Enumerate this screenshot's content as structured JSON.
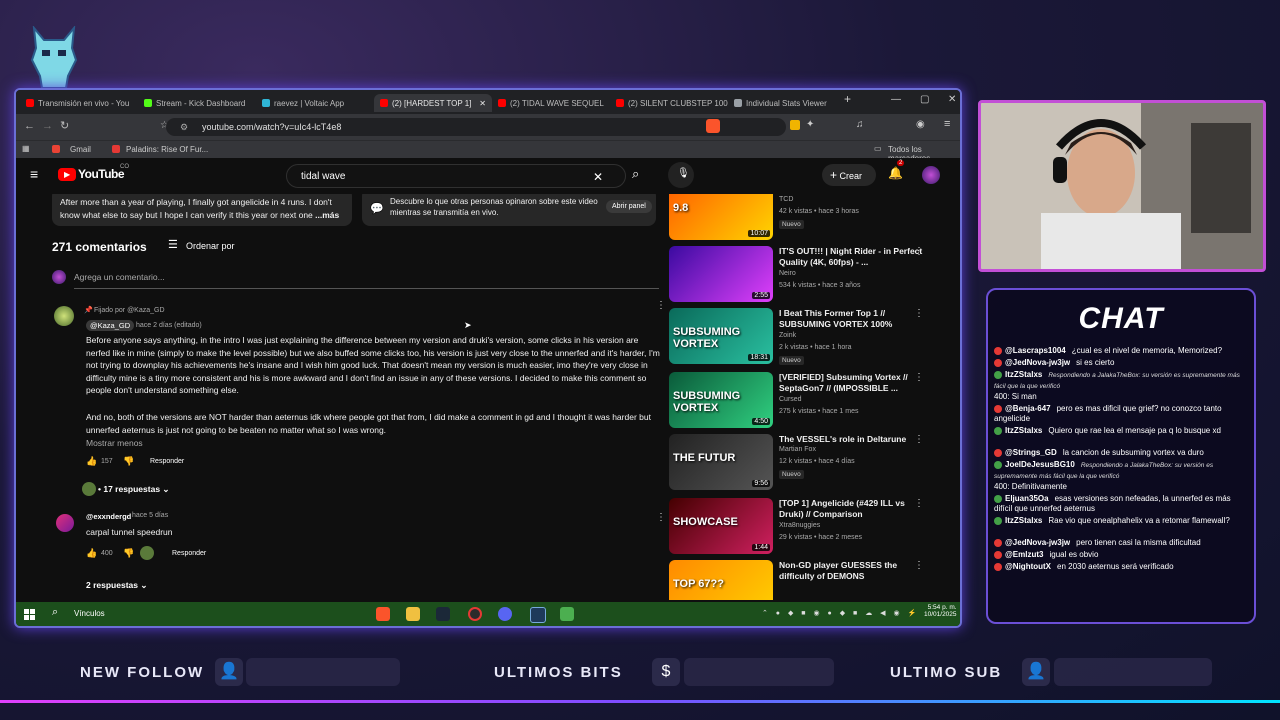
{
  "browser": {
    "tabs": [
      {
        "label": "Transmisión en vivo - You",
        "color": "#ff0000"
      },
      {
        "label": "Stream - Kick Dashboard",
        "color": "#53fc18"
      },
      {
        "label": "raevez | Voltaic App",
        "color": "#2fb5d6"
      },
      {
        "label": "(2) [HARDEST TOP 1] ",
        "color": "#ff0000",
        "active": true
      },
      {
        "label": "(2) TIDAL WAVE SEQUEL ",
        "color": "#ff0000"
      },
      {
        "label": "(2) SILENT CLUBSTEP 100%",
        "color": "#ff0000"
      },
      {
        "label": "Individual Stats Viewer",
        "color": "#9aa0a6"
      }
    ],
    "url": "youtube.com/watch?v=uIc4-lcT4e8",
    "bookmarks": [
      "Gmail",
      "Paladins: Rise Of Fur..."
    ],
    "bookmarks_all": "Todos los marcadores"
  },
  "youtube": {
    "logo": "YouTube",
    "logo_suffix": "CO",
    "search_value": "tidal wave",
    "create_label": "Crear",
    "notif_count": "2",
    "description_snippet": "After more than a year of playing, I finally got angelicide in 4 runs. I don't know what else to say but I hope I can verify it this year or next one ",
    "more_label": "...más",
    "live_panel_text": "Descubre lo que otras personas opinaron sobre este video mientras se transmitía en vivo.",
    "open_panel_label": "Abrir panel",
    "comments_count": "271 comentarios",
    "sort_label": "Ordenar por",
    "add_comment_placeholder": "Agrega un comentario...",
    "pinned_by": "Fijado por @Kaza_GD",
    "comments": [
      {
        "author": "@Kaza_GD",
        "time": "hace 2 días (editado)",
        "text1": "Before anyone says anything, in the intro I was just explaining the difference between my version and druki's version, some clicks in his version are nerfed like in mine (simply to make the level possible) but we also buffed some clicks too, his version is just very close to the unnerfed and it's harder, I'm not trying to downplay his achievements he's insane and I wish him good luck. That doesn't mean my version is much easier, imo they're very close in difficulty mine is a tiny more consistent and his is more awkward and I don't find an issue in any of these versions. I decided to make this comment so people don't understand something else.",
        "text2": "And no, both of the versions are NOT harder than aeternus idk where people got that from, I did make a comment in gd and I thought it was harder but unnerfed aeternus is just not going to be beaten no matter what so I was wrong.",
        "show_less": "Mostrar menos",
        "likes": "157",
        "reply_label": "Responder",
        "replies": "17 respuestas"
      },
      {
        "author": "@exxndergd",
        "time": "hace 5 días",
        "text1": "carpal tunnel speedrun",
        "likes": "400",
        "reply_label": "Responder",
        "replies": "2 respuestas"
      }
    ],
    "related": [
      {
        "title": "TCD vs GD SKILL TESTER",
        "channel": "TCD",
        "meta": "42 k vistas • hace 3 horas",
        "badge": "Nuevo",
        "duration": "10:07"
      },
      {
        "title": "IT'S OUT!!! | Night Rider - in Perfect Quality (4K, 60fps) - ...",
        "channel": "Neiro",
        "meta": "534 k vistas • hace 3 años",
        "badge": "",
        "duration": "2:55"
      },
      {
        "title": "I Beat This Former Top 1 // SUBSUMING VORTEX 100%",
        "channel": "Zoink",
        "meta": "2 k vistas • hace 1 hora",
        "badge": "Nuevo",
        "duration": "18:31"
      },
      {
        "title": "[VERIFIED] Subsuming Vortex // SeptaGon7 // (IMPOSSIBLE ...",
        "channel": "Cursed",
        "meta": "275 k vistas • hace 1 mes",
        "badge": "",
        "duration": "4:50"
      },
      {
        "title": "The VESSEL's role in Deltarune",
        "channel": "Martian Fox",
        "meta": "12 k vistas • hace 4 días",
        "badge": "Nuevo",
        "duration": "9:56"
      },
      {
        "title": "[TOP 1] Angelicide (#429 ILL vs Druki) // Comparison",
        "channel": "Xtra8nuggies",
        "meta": "29 k vistas • hace 2 meses",
        "badge": "",
        "duration": "1:44"
      },
      {
        "title": "Non-GD player GUESSES the difficulty of DEMONS",
        "channel": "",
        "meta": "",
        "badge": "",
        "duration": ""
      }
    ],
    "thumb_texts": [
      "9.8",
      "",
      "SUBSUMING VORTEX",
      "SUBSUMING VORTEX",
      "THE FUTUR",
      "SHOWCASE",
      "TOP 67??"
    ]
  },
  "taskbar": {
    "search_label": "Vínculos",
    "time": "5:54 p. m.",
    "date": "10/01/2025"
  },
  "chat": {
    "title": "CHAT",
    "messages": [
      {
        "user": "@Lascraps1004",
        "text": "¿cual es el nivel de memoria, Memorized?",
        "icon": "#e53935"
      },
      {
        "user": "@JedNova-jw3jw",
        "text": "si es cierto",
        "icon": "#e53935"
      },
      {
        "user": "ItzZStalxs",
        "reply": "Respondiendo a JalakaTheBox: su versión es supremamente más fácil que la que verificó",
        "text": "400: Si man",
        "icon": "#43a047"
      },
      {
        "user": "@Benja-647",
        "text": "pero es mas dificil que grief? no conozco tanto angelicide",
        "icon": "#e53935"
      },
      {
        "user": "ItzZStalxs",
        "text": "Quiero que rae lea el mensaje pa q lo busque xd",
        "icon": "#43a047"
      },
      {
        "user": "@Strings_GD",
        "text": "la cancion de subsuming vortex va duro",
        "icon": "#e53935"
      },
      {
        "user": "JoelDeJesusBG10",
        "reply": "Respondiendo a JalakaTheBox: su versión es supremamente más fácil que la que verificó",
        "text": "400: Definitivamente",
        "icon": "#43a047"
      },
      {
        "user": "Eljuan35Oa",
        "text": "esas versiones son nefeadas, la unnerfed es más difícil que unnerfed aeternus",
        "icon": "#43a047"
      },
      {
        "user": "ItzZStalxs",
        "text": "Rae vio que onealphahelix va a retomar flamewall?",
        "icon": "#43a047"
      },
      {
        "user": "@JedNova-jw3jw",
        "text": "pero tienen casi la misma dificultad",
        "icon": "#e53935"
      },
      {
        "user": "@Emlzut3",
        "text": "igual es obvio",
        "icon": "#e53935"
      },
      {
        "user": "@NightoutX",
        "text": "en 2030 aeternus será verificado",
        "icon": "#e53935"
      }
    ]
  },
  "overlay": {
    "new_follow": "NEW FOLLOW",
    "ultimos_bits": "ULTIMOS BITS",
    "ultimo_sub": "ULTIMO SUB"
  }
}
